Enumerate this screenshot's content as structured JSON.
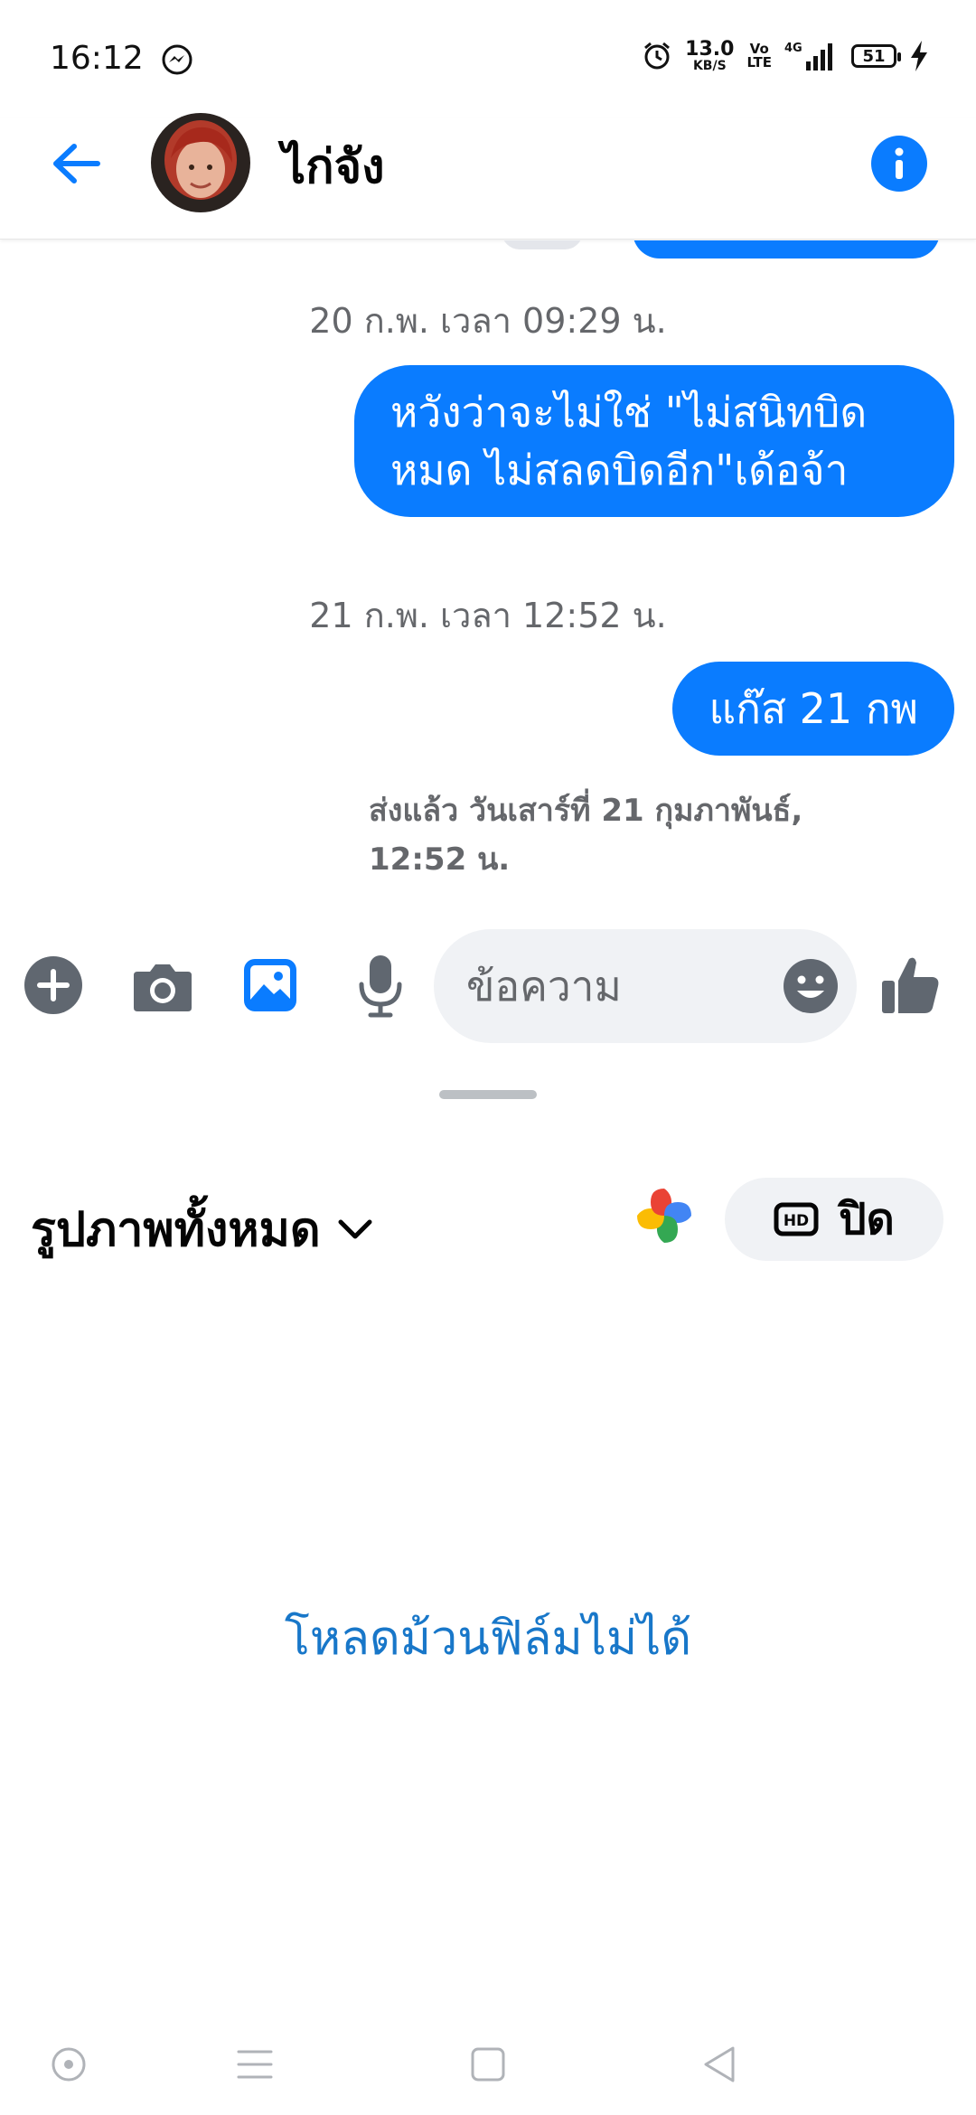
{
  "status_bar": {
    "time": "16:12",
    "net_speed_value": "13.0",
    "net_speed_unit": "KB/S",
    "volte_top": "Vo",
    "volte_bottom": "LTE",
    "network_type": "4G",
    "battery_level": "51",
    "icons": [
      "messenger-icon",
      "alarm-icon",
      "signal-icon",
      "battery-icon",
      "charging-bolt-icon"
    ]
  },
  "header": {
    "contact_name": "ไก่จัง",
    "icons": [
      "back-arrow-icon",
      "avatar",
      "info-icon"
    ]
  },
  "chat": {
    "messages": [
      {
        "timestamp": "20 ก.พ. เวลา 09:29 น.",
        "lines": [
          "หวังว่าจะไม่ใช่ \"ไม่สนิทบิด",
          "หมด ไม่สลดบิดอีก\"เด้อจ้า"
        ]
      },
      {
        "timestamp": "21 ก.พ. เวลา 12:52 น.",
        "lines": [
          "แก๊ส 21 กพ"
        ]
      }
    ],
    "delivered_status_line1": "ส่งแล้ว วันเสาร์ที่ 21 กุมภาพันธ์,",
    "delivered_status_line2": "12:52 น."
  },
  "composer": {
    "placeholder": "ข้อความ",
    "value": "",
    "icons": [
      "plus-icon",
      "camera-icon",
      "gallery-icon",
      "microphone-icon",
      "emoji-icon",
      "thumbs-up-icon"
    ]
  },
  "gallery": {
    "album_selector": "รูปภาพทั้งหมด",
    "hd_toggle_label": "ปิด",
    "hd_badge": "HD",
    "error_message": "โหลดม้วนฟิล์มไม่ได้"
  },
  "nav_bar": {
    "icons": [
      "assistant-icon",
      "menu-icon",
      "home-icon",
      "back-icon"
    ]
  },
  "colors": {
    "accent": "#0a7cff",
    "secondary_text": "#65676b",
    "link": "#1877c9",
    "field_bg": "#f0f2f5"
  }
}
